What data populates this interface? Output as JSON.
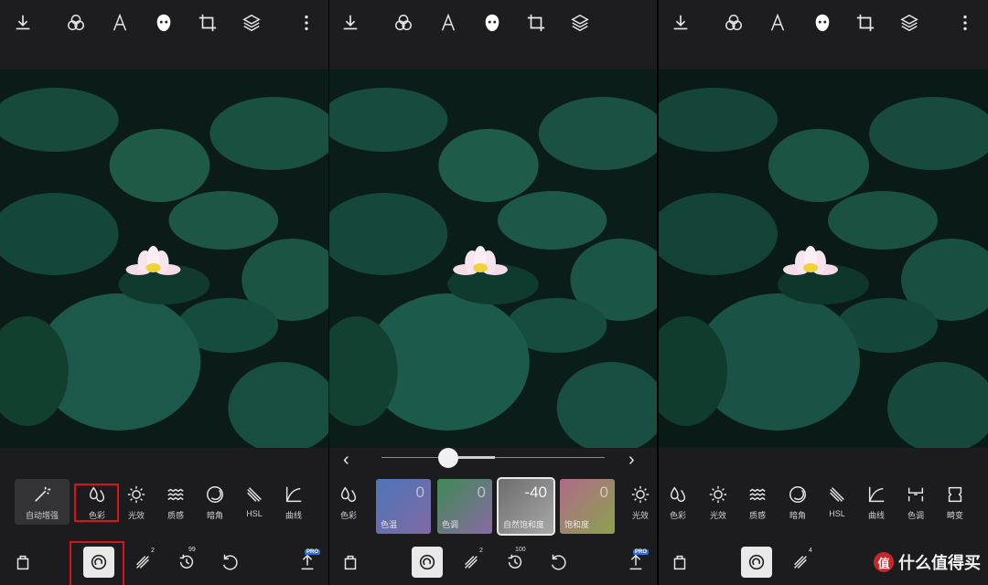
{
  "topbar": {
    "icons": [
      "download-icon",
      "filters-icon",
      "text-icon",
      "face-icon",
      "crop-icon",
      "layers-icon",
      "more-icon"
    ]
  },
  "panel1": {
    "tools": [
      {
        "icon": "wand-icon",
        "label": "自动增强"
      },
      {
        "icon": "drops-icon",
        "label": "色彩"
      },
      {
        "icon": "sun-icon",
        "label": "光效"
      },
      {
        "icon": "waves-icon",
        "label": "质感"
      },
      {
        "icon": "vignette-icon",
        "label": "暗角"
      },
      {
        "icon": "hsl-icon",
        "label": "HSL"
      },
      {
        "icon": "curve-icon",
        "label": "曲线"
      }
    ],
    "highlighted_tool": "色彩",
    "bottom": {
      "heal_count": "2",
      "history_count": "99",
      "pro_badge": "PRO"
    }
  },
  "panel2": {
    "slider": {
      "prev": "‹",
      "next": "›",
      "value_fraction": 0.3
    },
    "left_tool": {
      "label": "色彩"
    },
    "cards": [
      {
        "label": "色温",
        "value": "0",
        "from": "#4e74b8",
        "to": "#7f6aa4"
      },
      {
        "label": "色调",
        "value": "0",
        "from": "#3f8a55",
        "to": "#8a6aa4"
      },
      {
        "label": "自然饱和度",
        "value": "-40",
        "from": "#6d6d6d",
        "to": "#a8a8a8"
      },
      {
        "label": "饱和度",
        "value": "0",
        "from": "#b06a8a",
        "to": "#8aa24e"
      }
    ],
    "right_tool": {
      "label": "光效"
    },
    "bottom": {
      "heal_count": "2",
      "history_count": "100",
      "pro_badge": "PRO"
    }
  },
  "panel3": {
    "tools": [
      {
        "icon": "drops-icon",
        "label": "色彩"
      },
      {
        "icon": "sun-icon",
        "label": "光效"
      },
      {
        "icon": "waves-icon",
        "label": "质感"
      },
      {
        "icon": "vignette-icon",
        "label": "暗角"
      },
      {
        "icon": "hsl-icon",
        "label": "HSL"
      },
      {
        "icon": "curve-icon",
        "label": "曲线"
      },
      {
        "icon": "tone-icon",
        "label": "色调"
      },
      {
        "icon": "distort-icon",
        "label": "畸变"
      }
    ],
    "bottom": {
      "heal_count": "4"
    },
    "brand": {
      "logo": "值",
      "text": "什么值得买"
    }
  },
  "colors": {
    "highlight": "#d8141b",
    "pro": "#2f6fd6",
    "panel": "#1c1c1e"
  }
}
